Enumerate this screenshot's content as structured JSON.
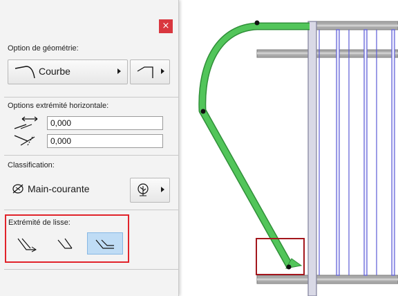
{
  "window": {
    "close_glyph": "×"
  },
  "geometry": {
    "label": "Option de géométrie:",
    "curve_button": "Courbe",
    "curve_icon": "curve-shape-icon",
    "angle_icon": "angle-shape-icon"
  },
  "horizontal_end": {
    "label": "Options extrémité horizontale:",
    "fields": [
      {
        "icon": "horizontal-offset-icon",
        "value": "0,000"
      },
      {
        "icon": "angled-offset-icon",
        "value": "0,000"
      }
    ]
  },
  "classification": {
    "label": "Classification:",
    "value": "Main-courante",
    "value_icon": "handrail-class-icon",
    "tree_icon": "classification-tree-icon"
  },
  "rail_end": {
    "label": "Extrémité de lisse:",
    "options": [
      {
        "icon": "rail-end-return-icon",
        "selected": false
      },
      {
        "icon": "rail-end-angled-icon",
        "selected": false
      },
      {
        "icon": "rail-end-straight-icon",
        "selected": true
      }
    ]
  },
  "colors": {
    "rail_green": "#52c55a",
    "highlight_red": "#e1232a",
    "callout_dark_red": "#a3161c",
    "selected_blue": "#bfdcf5",
    "post_outline": "#5b5bd6"
  }
}
